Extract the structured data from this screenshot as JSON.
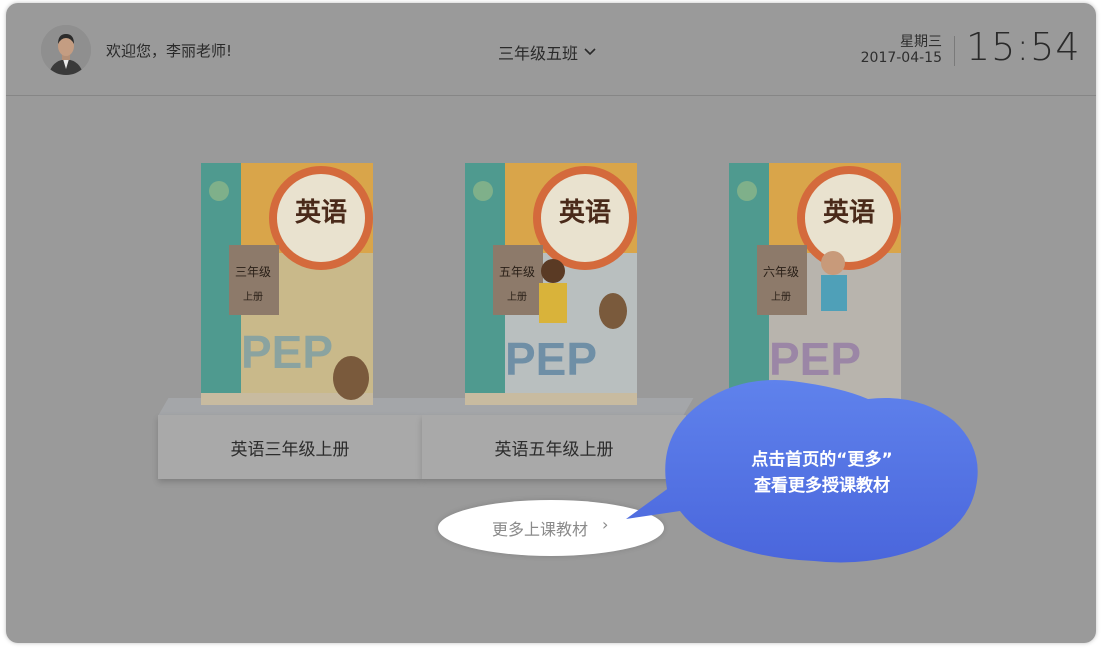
{
  "header": {
    "greeting": "欢迎您，李丽老师!",
    "class_selector": "三年级五班",
    "weekday": "星期三",
    "date": "2017-04-15",
    "time": "15:54"
  },
  "books": [
    {
      "title": "英语",
      "grade": "三年级",
      "volume": "上册",
      "label": "英语三年级上册"
    },
    {
      "title": "英语",
      "grade": "五年级",
      "volume": "上册",
      "label": "英语五年级上册"
    },
    {
      "title": "英语",
      "grade": "六年级",
      "volume": "上册",
      "label": ""
    }
  ],
  "book_badge": "PEP",
  "more_button": {
    "label": "更多上课教材",
    "icon": "chevron-right-icon"
  },
  "tooltip": {
    "line1": "点击首页的“更多”",
    "line2": "查看更多授课教材",
    "color": "#5474e6"
  },
  "colors": {
    "overlay": "#9a9a9a",
    "accent": "#5474e6",
    "book_orange": "#d99a3e",
    "book_teal": "#3f8f8a"
  }
}
